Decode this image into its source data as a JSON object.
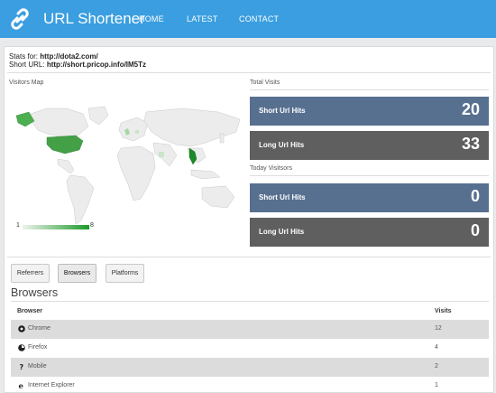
{
  "header": {
    "brand": "URL Shortener",
    "nav": [
      "HOME",
      "LATEST",
      "CONTACT"
    ]
  },
  "stats": {
    "stats_for_label": "Stats for:",
    "stats_for_url": "http://dota2.com/",
    "short_url_label": "Short URL:",
    "short_url": "http://short.pricop.info/IM5Tz"
  },
  "map": {
    "title": "Visitors Map",
    "legend_min": "1",
    "legend_max": "8"
  },
  "totals": {
    "title": "Total Visits",
    "short_label": "Short Url Hits",
    "short_value": "20",
    "long_label": "Long Url Hits",
    "long_value": "33"
  },
  "today": {
    "title": "Today Visitsors",
    "short_label": "Short Url Hits",
    "short_value": "0",
    "long_label": "Long Url Hits",
    "long_value": "0"
  },
  "tabs": [
    "Referrers",
    "Browsers",
    "Platforms"
  ],
  "table": {
    "title": "Browsers",
    "col_browser": "Browser",
    "col_visits": "Visits",
    "rows": [
      {
        "icon": "chrome-icon",
        "name": "Chrome",
        "visits": "12"
      },
      {
        "icon": "firefox-icon",
        "name": "Firefox",
        "visits": "4"
      },
      {
        "icon": "question-icon",
        "name": "Mobile",
        "visits": "2"
      },
      {
        "icon": "ie-icon",
        "name": "Internet Explorer",
        "visits": "1"
      }
    ]
  },
  "colors": {
    "header_blue": "#3a9ee0",
    "stat_blue": "#577090",
    "stat_gray": "#5f5f5f",
    "map_green": "#1a9a2a"
  }
}
